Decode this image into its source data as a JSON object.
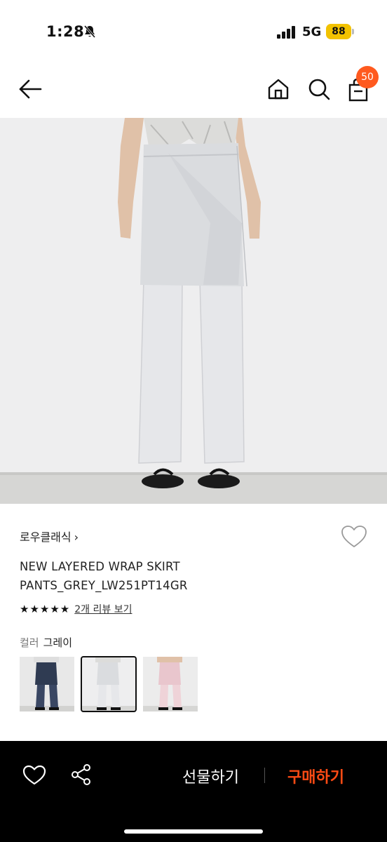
{
  "status_bar": {
    "time": "1:28",
    "network": "5G",
    "battery": "88",
    "icons": [
      "bell-slash-icon",
      "signal-icon"
    ]
  },
  "nav": {
    "icons": [
      "back-arrow-icon",
      "home-icon",
      "search-icon",
      "shopping-bag-icon"
    ],
    "cart_count": "50",
    "badge_color": "#ff5a1f"
  },
  "product": {
    "brand": "로우클래식",
    "brand_chevron": "›",
    "name_line1": "NEW LAYERED WRAP SKIRT",
    "name_line2": "PANTS_GREY_LW251PT14GR",
    "stars": "★★★★★",
    "rating_value": 5,
    "rating_max": 5,
    "review_link": "2개 리뷰 보기",
    "color_label": "컬러",
    "color_value": "그레이",
    "swatches": [
      {
        "name": "navy",
        "selected": false,
        "color": "#2f3b52"
      },
      {
        "name": "grey",
        "selected": true,
        "color": "#d8d9dd"
      },
      {
        "name": "pink",
        "selected": false,
        "color": "#e9c6cd"
      }
    ]
  },
  "bottom_bar": {
    "gift_label": "선물하기",
    "buy_label": "구매하기",
    "buy_color": "#ff4b14",
    "icons": [
      "heart-outline-icon",
      "share-icon"
    ]
  }
}
